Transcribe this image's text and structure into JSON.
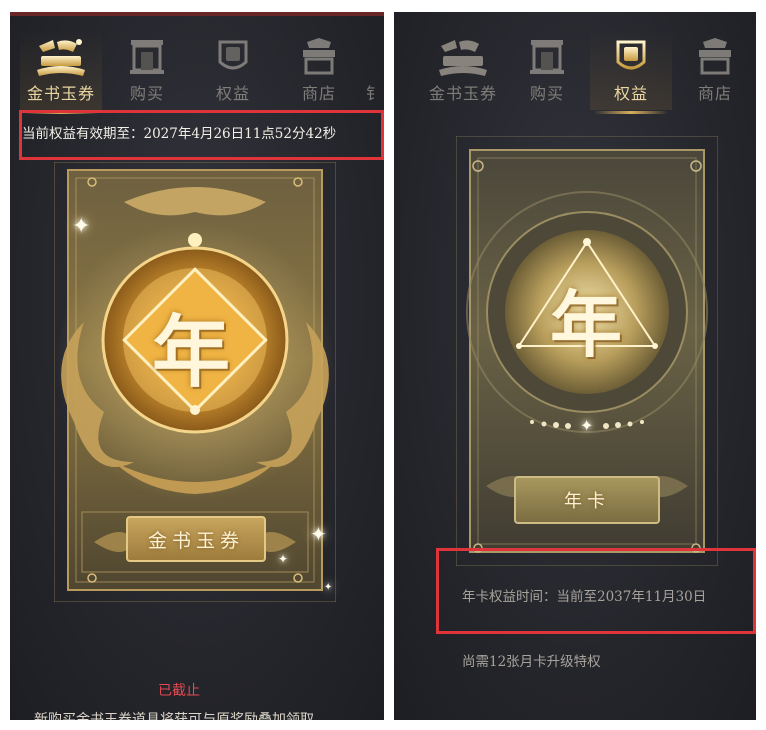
{
  "left_screen": {
    "tabs": [
      {
        "label": "金书玉券",
        "icon": "gold-book-icon",
        "active": true
      },
      {
        "label": "购买",
        "icon": "shop-gate-icon",
        "active": false
      },
      {
        "label": "权益",
        "icon": "shield-badge-icon",
        "active": false
      },
      {
        "label": "商店",
        "icon": "treasure-chest-icon",
        "active": false
      },
      {
        "label": "钅",
        "icon": "",
        "active": false
      }
    ],
    "validity_text": "当前权益有效期至：2027年4月26日11点52分42秒",
    "card": {
      "emblem_char": "年",
      "button_label": "金书玉券"
    },
    "status_text": "已截止",
    "footer_text": "新购买金书玉券道具将获可与原奖励叠加领取"
  },
  "right_screen": {
    "tabs": [
      {
        "label": "金书玉券",
        "icon": "gold-book-icon",
        "active": false
      },
      {
        "label": "购买",
        "icon": "shop-gate-icon",
        "active": false
      },
      {
        "label": "权益",
        "icon": "shield-badge-icon",
        "active": true
      },
      {
        "label": "商店",
        "icon": "treasure-chest-icon",
        "active": false
      }
    ],
    "card": {
      "emblem_char": "年",
      "button_label": "年卡"
    },
    "benefit_time_text": "年卡权益时间：当前至2037年11月30日",
    "upgrade_text": "尚需12张月卡升级特权"
  },
  "colors": {
    "highlight": "#e0343b",
    "gold": "#d8ae5c",
    "status_red": "#e34a50",
    "background": "#25262c"
  }
}
